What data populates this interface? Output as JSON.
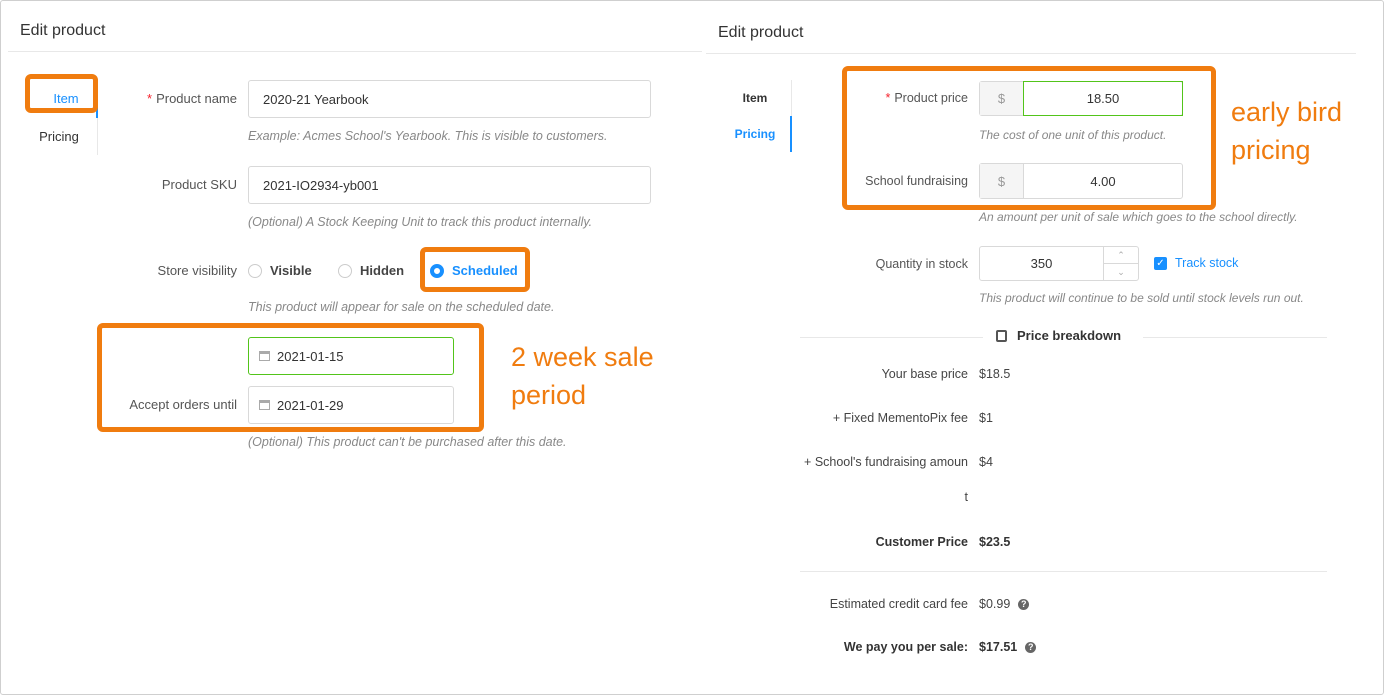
{
  "left": {
    "title": "Edit product",
    "tabs": {
      "item": "Item",
      "pricing": "Pricing"
    },
    "product_name": {
      "label": "Product name",
      "required": "*",
      "value": "2020-21 Yearbook",
      "help": "Example: Acmes School's Yearbook. This is visible to customers."
    },
    "sku": {
      "label": "Product SKU",
      "value": "2021-IO2934-yb001",
      "help": "(Optional) A Stock Keeping Unit to track this product internally."
    },
    "visibility": {
      "label": "Store visibility",
      "options": [
        "Visible",
        "Hidden",
        "Scheduled"
      ],
      "selected": "Scheduled",
      "help": "This product will appear for sale on the scheduled date."
    },
    "dates": {
      "start": "2021-01-15",
      "until_label": "Accept orders until",
      "until": "2021-01-29",
      "help": "(Optional) This product can't be purchased after this date."
    },
    "annotation": {
      "line1": "2 week sale",
      "line2": "period"
    }
  },
  "right": {
    "title": "Edit product",
    "tabs": {
      "item": "Item",
      "pricing": "Pricing"
    },
    "price": {
      "label": "Product price",
      "required": "*",
      "prefix": "$",
      "value": "18.50",
      "help": "The cost of one unit of this product."
    },
    "fundraising": {
      "label": "School fundraising",
      "prefix": "$",
      "value": "4.00",
      "help": "An amount per unit of sale which goes to the school directly."
    },
    "stock": {
      "label": "Quantity in stock",
      "value": "350",
      "track_label": "Track stock",
      "help": "This product will continue to be sold until stock levels run out."
    },
    "breakdown": {
      "title": "Price breakdown",
      "base_label": "Your base price",
      "base_value": "$18.5",
      "fee_label": "+ Fixed MementoPix fee",
      "fee_value": "$1",
      "fund_label_1": "+ School's fundraising amoun",
      "fund_label_2": "t",
      "fund_value": "$4",
      "customer_label": "Customer Price",
      "customer_value": "$23.5",
      "cc_label": "Estimated credit card fee",
      "cc_value": "$0.99",
      "pay_label": "We pay you per sale:",
      "pay_value": "$17.51"
    },
    "annotation": {
      "line1": "early bird",
      "line2": "pricing"
    }
  },
  "colors": {
    "accent": "#1890ff",
    "highlight": "#f07c0f",
    "success": "#52c41a"
  }
}
